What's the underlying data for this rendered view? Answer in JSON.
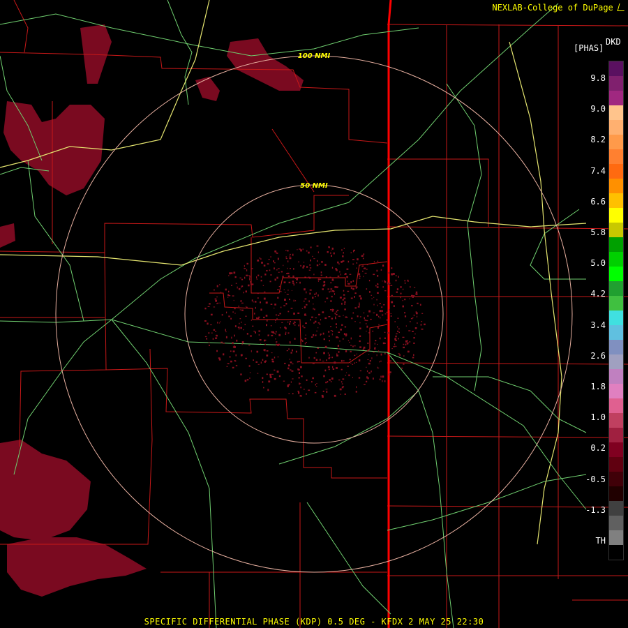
{
  "credit": "NEXLAB-College of DuPage",
  "credit_icon": "cod-logo-icon",
  "legend": {
    "unit": "[PHAS]",
    "product": "DKD",
    "labels": [
      "9.8",
      "9.0",
      "8.2",
      "7.4",
      "6.6",
      "5.8",
      "5.0",
      "4.2",
      "3.4",
      "2.6",
      "1.8",
      "1.0",
      "0.2",
      "-0.5",
      "-1.3",
      "TH"
    ],
    "colors": [
      "#5a1060",
      "#80206e",
      "#a02880",
      "#ffc48c",
      "#ffb070",
      "#ff9a4a",
      "#ff8030",
      "#ff6a10",
      "#ff9000",
      "#ffc000",
      "#ffff00",
      "#c8c800",
      "#00a000",
      "#00d000",
      "#00ff00",
      "#20a030",
      "#40c040",
      "#40e0e0",
      "#60c0e0",
      "#8090c0",
      "#a0a0c0",
      "#c080c0",
      "#e080c0",
      "#e06090",
      "#c04060",
      "#a02040",
      "#800020",
      "#600010",
      "#400008",
      "#200000",
      "#404040",
      "#606060",
      "#808080",
      "#000000"
    ]
  },
  "range_rings": [
    {
      "label": "50 NMI"
    },
    {
      "label": "100 NMI"
    }
  ],
  "footer": "SPECIFIC DIFFERENTIAL PHASE (KDP) 0.5 DEG - KFDX 2 MAY 25 22:30"
}
